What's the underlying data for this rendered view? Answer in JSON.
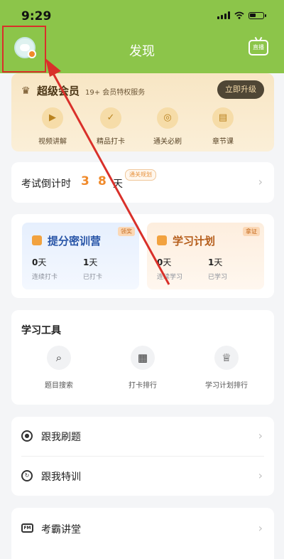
{
  "status_bar": {
    "time": "9:29"
  },
  "header": {
    "title": "发现",
    "live_label": "直播"
  },
  "vip": {
    "title": "超级会员",
    "subtitle": "19+ 会员特权服务",
    "upgrade_label": "立即升级",
    "features": [
      {
        "label": "视频讲解",
        "icon": "play-icon"
      },
      {
        "label": "精品打卡",
        "icon": "check-icon"
      },
      {
        "label": "通关必刷",
        "icon": "target-icon"
      },
      {
        "label": "章节课",
        "icon": "book-icon"
      }
    ]
  },
  "countdown": {
    "label": "考试倒计时",
    "digit1": "3",
    "digit2": "8",
    "unit": "天",
    "tag": "通关规划"
  },
  "camps": [
    {
      "title": "提分密训营",
      "tag": "领奖",
      "stat1_value": "0",
      "stat1_unit": "天",
      "stat1_label": "连续打卡",
      "stat2_value": "1",
      "stat2_unit": "天",
      "stat2_label": "已打卡"
    },
    {
      "title": "学习计划",
      "tag": "拿证",
      "stat1_value": "0",
      "stat1_unit": "天",
      "stat1_label": "连续学习",
      "stat2_value": "1",
      "stat2_unit": "天",
      "stat2_label": "已学习"
    }
  ],
  "tools": {
    "title": "学习工具",
    "items": [
      {
        "label": "题目搜索",
        "icon": "search-list-icon"
      },
      {
        "label": "打卡排行",
        "icon": "calendar-chart-icon"
      },
      {
        "label": "学习计划排行",
        "icon": "trophy-icon"
      }
    ]
  },
  "list": [
    {
      "label": "跟我刷题",
      "icon": "target-icon"
    },
    {
      "label": "跟我特训",
      "icon": "refresh-icon"
    }
  ],
  "list2": [
    {
      "label": "考霸讲堂",
      "icon": "fm-icon",
      "icon_text": "FM"
    }
  ],
  "annotation": {
    "color": "#d9302a"
  }
}
